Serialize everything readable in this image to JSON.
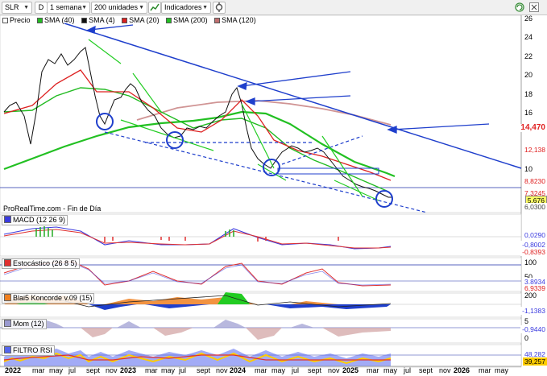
{
  "toolbar": {
    "symbol": "SLR",
    "d_label": "D",
    "timeframe": "1 semana",
    "units": "200 unidades",
    "indicators_label": "Indicadores"
  },
  "legend": {
    "precio": "Precio",
    "sma40": "SMA (40)",
    "sma4": "SMA (4)",
    "sma20": "SMA (20)",
    "sma200": "SMA (200)",
    "sma120": "SMA (120)"
  },
  "price_axis": [
    "26",
    "24",
    "22",
    "20",
    "18",
    "16",
    "10"
  ],
  "price_tags": {
    "t1": "14,470",
    "t2": "12,138",
    "t3": "8,8230",
    "t4": "7,3245",
    "t5": "5,676",
    "t6": "6,0300"
  },
  "footer": "ProRealTime.com - Fin de Día",
  "macd": {
    "label": "MACD (12 26 9)",
    "tags": [
      "0,0290",
      "-0,8002",
      "-0,8393"
    ]
  },
  "stoch": {
    "label": "Estocástico (26 8 5)",
    "axis": [
      "100",
      "50"
    ],
    "tags": [
      "3,8934",
      "6,9339"
    ]
  },
  "koncorde": {
    "label": "Blai5 Koncorde v.09 (15)",
    "axis": [
      "200"
    ],
    "tags": [
      "-1,1383"
    ]
  },
  "mom": {
    "label": "Mom (12)",
    "axis": [
      "5",
      "0"
    ],
    "tags": [
      "-0,9440"
    ]
  },
  "rsi": {
    "label": "FILTRO RSI",
    "tags": [
      "48,282",
      "39,257"
    ]
  },
  "x_axis": [
    "2022",
    "mar",
    "may",
    "jul",
    "sept",
    "nov",
    "2023",
    "mar",
    "may",
    "jul",
    "sept",
    "nov",
    "2024",
    "mar",
    "may",
    "jul",
    "sept",
    "nov",
    "2025",
    "mar",
    "may",
    "jul",
    "sept",
    "nov",
    "2026",
    "mar",
    "may"
  ],
  "colors": {
    "trend_line": "#1f3fcc",
    "sma_green": "#22cc22",
    "sma_red": "#e02020",
    "price_tag_red": "#e02020",
    "macd_blue": "#3a3adf"
  }
}
